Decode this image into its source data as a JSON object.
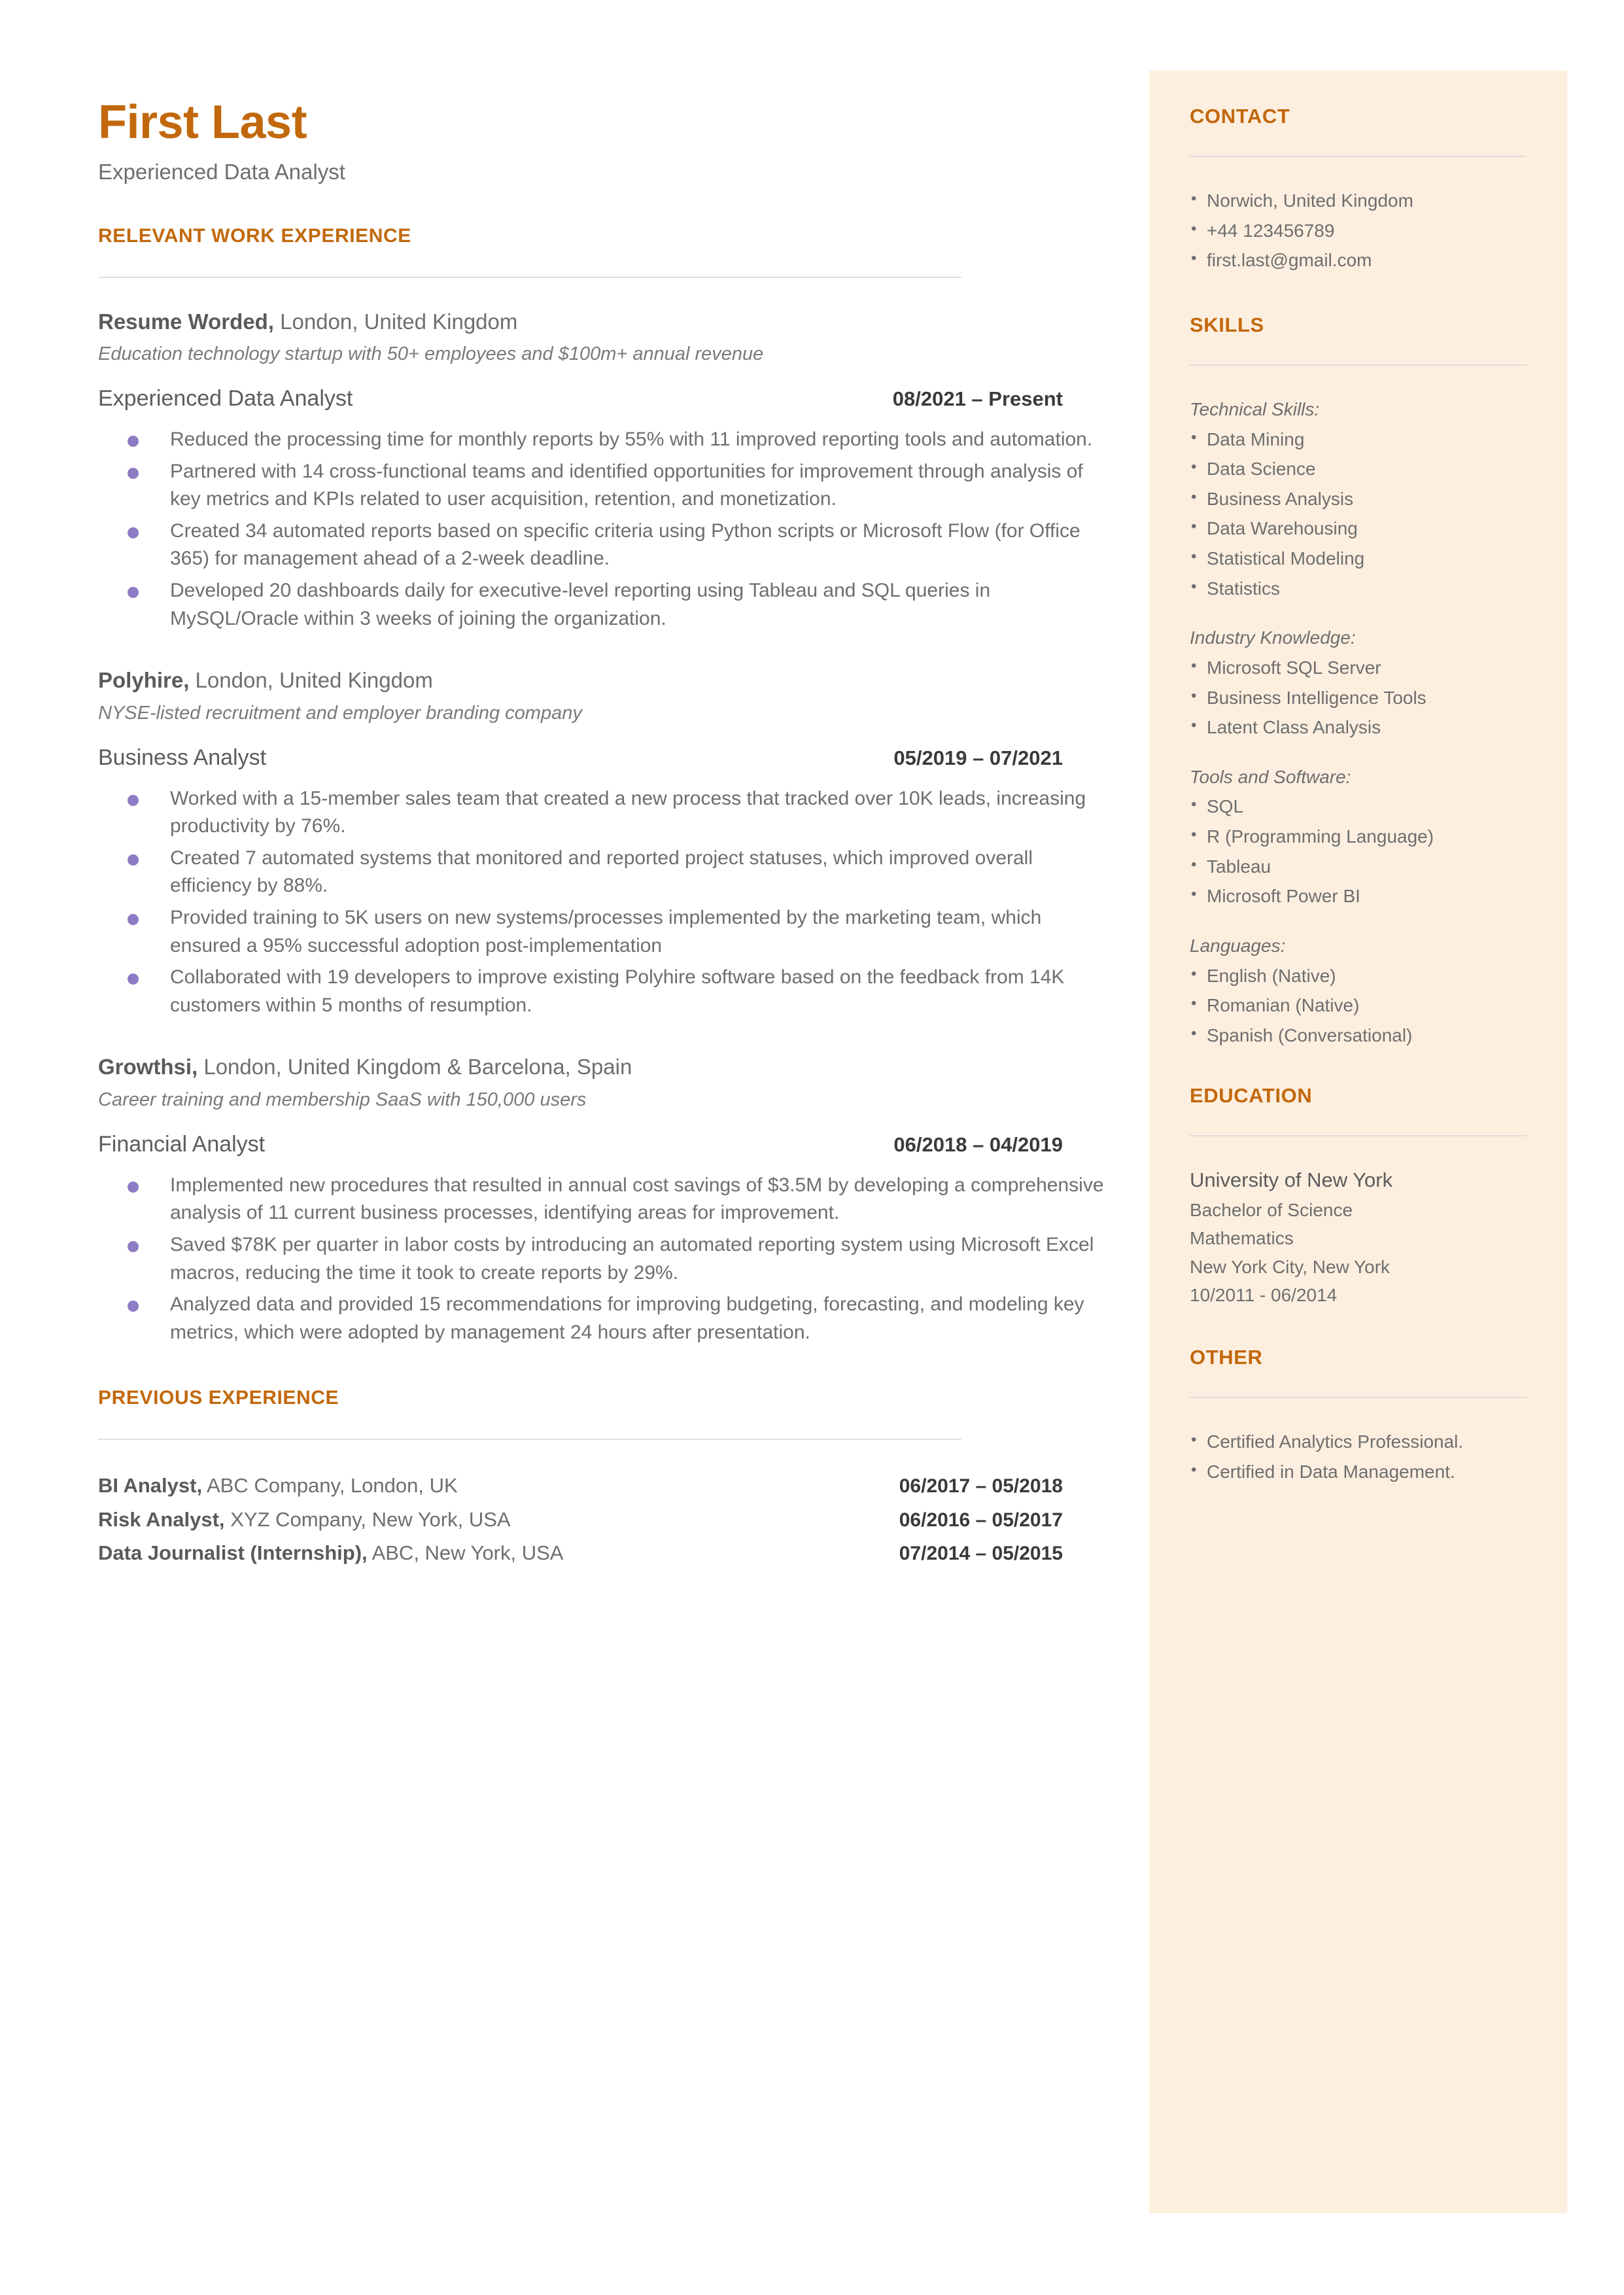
{
  "header": {
    "name": "First Last",
    "tagline": "Experienced Data Analyst"
  },
  "main": {
    "work_heading": "RELEVANT WORK EXPERIENCE",
    "previous_heading": "PREVIOUS EXPERIENCE",
    "jobs": [
      {
        "company": "Resume Worded,",
        "location": " London, United Kingdom",
        "description": "Education technology startup with 50+ employees and $100m+ annual revenue",
        "role": "Experienced Data Analyst",
        "dates": "08/2021 – Present",
        "bullets": [
          "Reduced the processing time for monthly reports by 55% with 11 improved reporting tools and automation.",
          "Partnered with 14 cross-functional teams and identified opportunities for improvement through analysis of key metrics and KPIs related to user acquisition, retention, and monetization.",
          "Created 34 automated reports based on specific criteria using Python scripts or Microsoft Flow (for Office 365) for management ahead of a 2-week deadline.",
          "Developed 20 dashboards daily for executive-level reporting using Tableau and SQL queries in MySQL/Oracle within 3 weeks of joining the organization."
        ]
      },
      {
        "company": "Polyhire,",
        "location": " London, United Kingdom",
        "description": "NYSE-listed recruitment and employer branding company",
        "role": "Business Analyst",
        "dates": "05/2019 – 07/2021",
        "bullets": [
          "Worked with a 15-member sales team that created a new process that tracked over 10K leads, increasing productivity by 76%.",
          "Created 7 automated systems that monitored and reported project statuses, which improved overall efficiency by 88%.",
          "Provided training to 5K users on new systems/processes implemented by the marketing team, which ensured a 95% successful adoption post-implementation",
          "Collaborated with 19 developers to improve existing Polyhire software based on the feedback from 14K customers within 5 months of resumption."
        ]
      },
      {
        "company": "Growthsi,",
        "location": " London, United Kingdom & Barcelona, Spain",
        "description": "Career training and membership SaaS with 150,000 users",
        "role": "Financial Analyst",
        "dates": "06/2018 – 04/2019",
        "bullets": [
          "Implemented new procedures that resulted in annual cost savings of $3.5M by developing a comprehensive analysis of 11 current business processes, identifying areas for improvement.",
          "Saved $78K per quarter in labor costs by introducing an automated reporting system using Microsoft Excel macros, reducing the time it took to create reports by 29%.",
          "Analyzed data and provided 15 recommendations for improving budgeting, forecasting, and modeling key metrics, which were adopted by management 24 hours after presentation."
        ]
      }
    ],
    "previous": [
      {
        "title": "BI Analyst,",
        "detail": " ABC Company, London, UK",
        "dates": "06/2017 – 05/2018"
      },
      {
        "title": "Risk Analyst,",
        "detail": " XYZ Company, New York, USA",
        "dates": "06/2016 – 05/2017"
      },
      {
        "title": "Data Journalist (Internship),",
        "detail": " ABC, New York, USA",
        "dates": "07/2014 – 05/2015"
      }
    ]
  },
  "sidebar": {
    "contact": {
      "heading": "CONTACT",
      "items": [
        "Norwich, United Kingdom",
        "+44 123456789",
        "first.last@gmail.com"
      ]
    },
    "skills": {
      "heading": "SKILLS",
      "groups": [
        {
          "label": "Technical Skills:",
          "items": [
            "Data Mining",
            "Data Science",
            "Business Analysis",
            "Data Warehousing",
            "Statistical Modeling",
            "Statistics"
          ]
        },
        {
          "label": "Industry Knowledge:",
          "items": [
            "Microsoft SQL Server",
            "Business Intelligence Tools",
            "Latent Class Analysis"
          ]
        },
        {
          "label": "Tools and Software:",
          "items": [
            "SQL",
            "R (Programming Language)",
            "Tableau",
            "Microsoft Power BI"
          ]
        },
        {
          "label": "Languages:",
          "items": [
            "English (Native)",
            "Romanian (Native)",
            "Spanish (Conversational)"
          ]
        }
      ]
    },
    "education": {
      "heading": "EDUCATION",
      "school": "University of New York",
      "degree": "Bachelor of Science",
      "major": "Mathematics",
      "location": "New York City, New York",
      "dates": "10/2011 - 06/2014"
    },
    "other": {
      "heading": "OTHER",
      "items": [
        "Certified Analytics Professional.",
        "Certified in Data Management."
      ]
    }
  },
  "colors": {
    "accent": "#C2680C",
    "sidebar_bg": "#FDEFDF",
    "body_text": "#6E6E6E",
    "bullet": "#8D7CC4"
  }
}
